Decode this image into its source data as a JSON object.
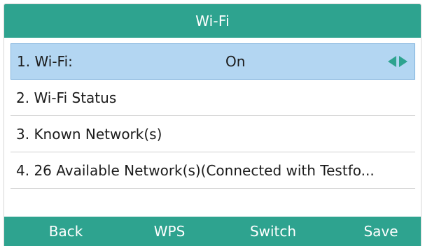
{
  "header": {
    "title": "Wi-Fi"
  },
  "menu": {
    "items": [
      {
        "label": "1. Wi-Fi:",
        "value": "On"
      },
      {
        "label": "2. Wi-Fi Status"
      },
      {
        "label": "3. Known Network(s)"
      },
      {
        "label": "4. 26 Available Network(s)(Connected with Testfo..."
      }
    ],
    "selected_index": 0,
    "selector_icons": [
      "arrow-left-icon",
      "arrow-right-icon"
    ]
  },
  "softkeys": {
    "back": "Back",
    "wps": "WPS",
    "switch": "Switch",
    "save": "Save"
  },
  "colors": {
    "accent": "#2ea38f",
    "selection": "#b3d6f2",
    "text": "#1c1c1c"
  }
}
